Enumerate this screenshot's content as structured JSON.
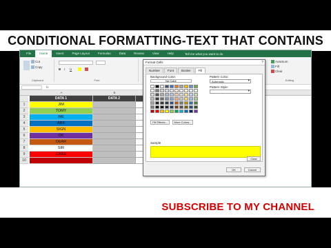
{
  "title": "CONDITIONAL FORMATTING-TEXT THAT CONTAINS",
  "subscribe": "SUBSCRIBE TO MY  CHANNEL",
  "ribbon": {
    "tabs": [
      "File",
      "Home",
      "Insert",
      "Page Layout",
      "Formulas",
      "Data",
      "Review",
      "View",
      "Help"
    ],
    "active_tab": "Home",
    "tell_me": "Tell me what you want to do",
    "clipboard": {
      "cut": "Cut",
      "copy": "Copy",
      "label": "Clipboard"
    },
    "font_label": "Font",
    "editing": {
      "autosum": "AutoSum",
      "fill": "Fill",
      "clear": "Clear",
      "label": "Editing"
    }
  },
  "sheet": {
    "columns": [
      "A",
      "B",
      "C"
    ],
    "headers": [
      "DATA 1",
      "DATA 2",
      "REMAR"
    ],
    "rows": [
      {
        "num": "1",
        "value": "JIM",
        "color": "#ffff00",
        "text": "#111111"
      },
      {
        "num": "2",
        "value": "TOMY",
        "color": "#92d050",
        "text": "#111111"
      },
      {
        "num": "3",
        "value": "WE",
        "color": "#00b0f0",
        "text": "#111111"
      },
      {
        "num": "4",
        "value": "ARK",
        "color": "#0070c0",
        "text": "#111111"
      },
      {
        "num": "5",
        "value": "SIGN",
        "color": "#ffc000",
        "text": "#111111"
      },
      {
        "num": "6",
        "value": "OK",
        "color": "#7030a0",
        "text": "#111111"
      },
      {
        "num": "7",
        "value": "DEAR",
        "color": "#c65911",
        "text": "#111111"
      },
      {
        "num": "8",
        "value": "SIR",
        "color": "#ffffff",
        "text": "#111111"
      },
      {
        "num": "9",
        "value": "CARE",
        "color": "#ff0000",
        "text": "#111111"
      },
      {
        "num": "10",
        "value": "",
        "color": "#c00000",
        "text": "#111111"
      }
    ]
  },
  "dialog": {
    "title": "Format Cells",
    "close": "?",
    "tabs": [
      "Number",
      "Font",
      "Border",
      "Fill"
    ],
    "active_tab": "Fill",
    "background_color_label": "Background Color:",
    "no_color": "No Color",
    "pattern_color_label": "Pattern Color:",
    "pattern_color_value": "Automatic",
    "pattern_style_label": "Pattern Style:",
    "fill_effects": "Fill Effects...",
    "more_colors": "More Colors...",
    "sample_label": "Sample",
    "sample_color": "#ffff00",
    "clear": "Clear",
    "ok": "OK",
    "cancel": "Cancel"
  }
}
